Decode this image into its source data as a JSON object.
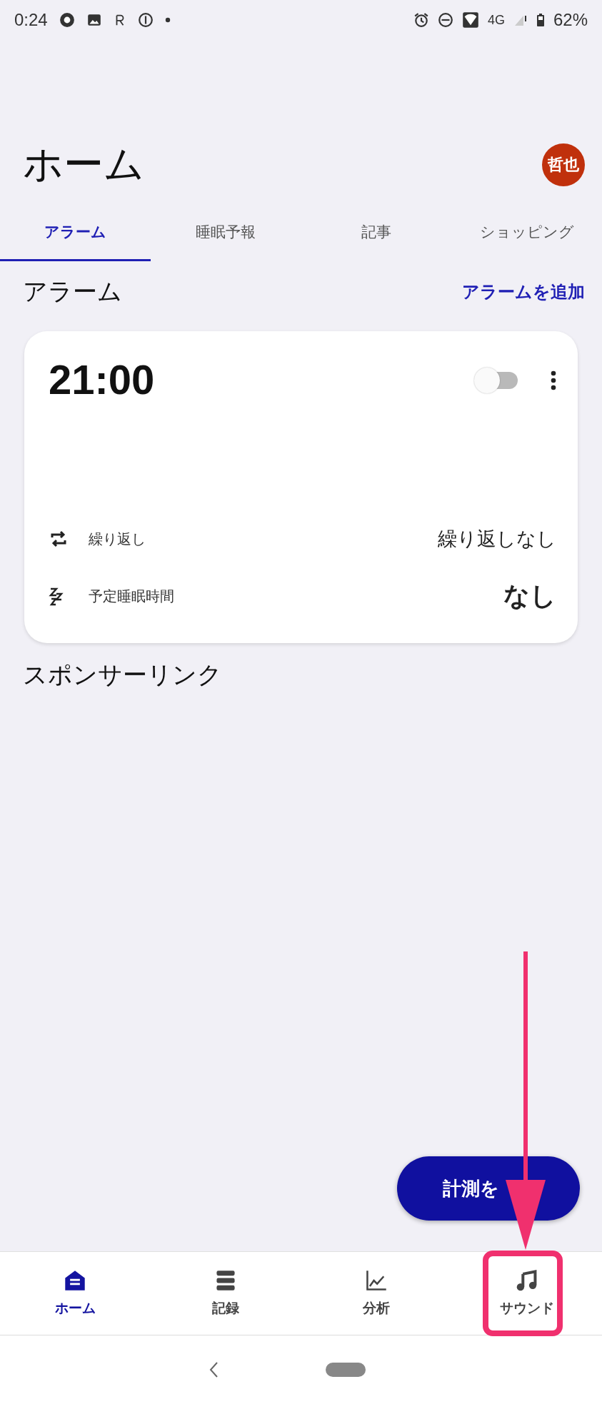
{
  "status_bar": {
    "time": "0:24",
    "network": "4G",
    "battery": "62%"
  },
  "header": {
    "title": "ホーム",
    "avatar": "哲也"
  },
  "tabs": [
    {
      "label": "アラーム",
      "selected": true
    },
    {
      "label": "睡眠予報",
      "selected": false
    },
    {
      "label": "記事",
      "selected": false
    },
    {
      "label": "ショッピング",
      "selected": false
    }
  ],
  "section": {
    "title": "アラーム",
    "action": "アラームを追加"
  },
  "alarm_card": {
    "time": "21:00",
    "enabled": false,
    "rows": [
      {
        "kind": "repeat",
        "label": "繰り返し",
        "value": "繰り返しなし"
      },
      {
        "kind": "sleep",
        "label": "予定睡眠時間",
        "value": "なし"
      }
    ]
  },
  "sponsored": {
    "title": "スポンサーリンク"
  },
  "fab": {
    "label": "計測を"
  },
  "bottom_nav": [
    {
      "kind": "home",
      "label": "ホーム",
      "selected": true
    },
    {
      "kind": "records",
      "label": "記録",
      "selected": false
    },
    {
      "kind": "analysis",
      "label": "分析",
      "selected": false
    },
    {
      "kind": "sound",
      "label": "サウンド",
      "selected": false
    }
  ]
}
